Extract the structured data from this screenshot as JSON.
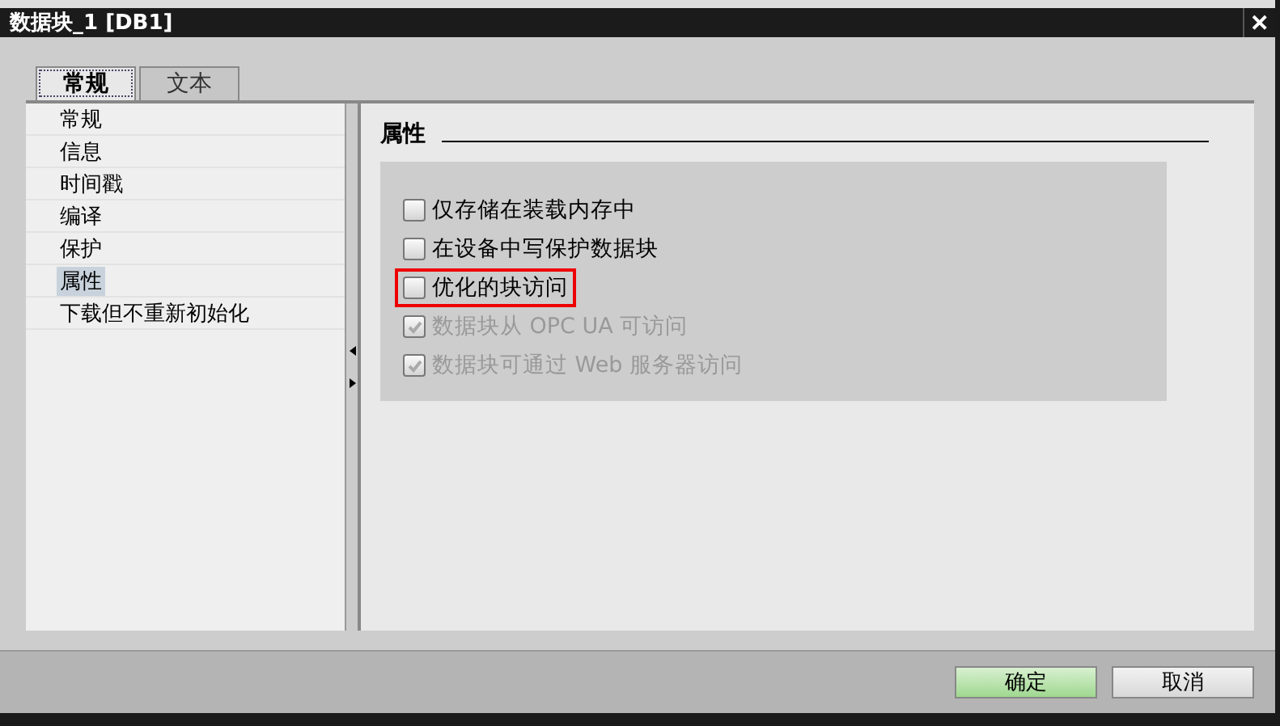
{
  "window": {
    "title": "数据块_1 [DB1]",
    "close": "✕"
  },
  "tabs": [
    {
      "label": "常规",
      "selected": true
    },
    {
      "label": "文本",
      "selected": false
    }
  ],
  "nav": [
    {
      "label": "常规",
      "selected": false
    },
    {
      "label": "信息",
      "selected": false
    },
    {
      "label": "时间戳",
      "selected": false
    },
    {
      "label": "编译",
      "selected": false
    },
    {
      "label": "保护",
      "selected": false
    },
    {
      "label": "属性",
      "selected": true
    },
    {
      "label": "下载但不重新初始化",
      "selected": false
    }
  ],
  "section": {
    "title": "属性"
  },
  "options": [
    {
      "label": "仅存储在装载内存中",
      "checked": false,
      "disabled": false,
      "highlighted": false
    },
    {
      "label": "在设备中写保护数据块",
      "checked": false,
      "disabled": false,
      "highlighted": false
    },
    {
      "label": "优化的块访问",
      "checked": false,
      "disabled": false,
      "highlighted": true
    },
    {
      "label": "数据块从 OPC UA 可访问",
      "checked": true,
      "disabled": true,
      "highlighted": false
    },
    {
      "label": "数据块可通过 Web 服务器访问",
      "checked": true,
      "disabled": true,
      "highlighted": false
    }
  ],
  "buttons": [
    {
      "label": "确定",
      "kind": "primary"
    },
    {
      "label": "取消",
      "kind": "secondary"
    }
  ]
}
